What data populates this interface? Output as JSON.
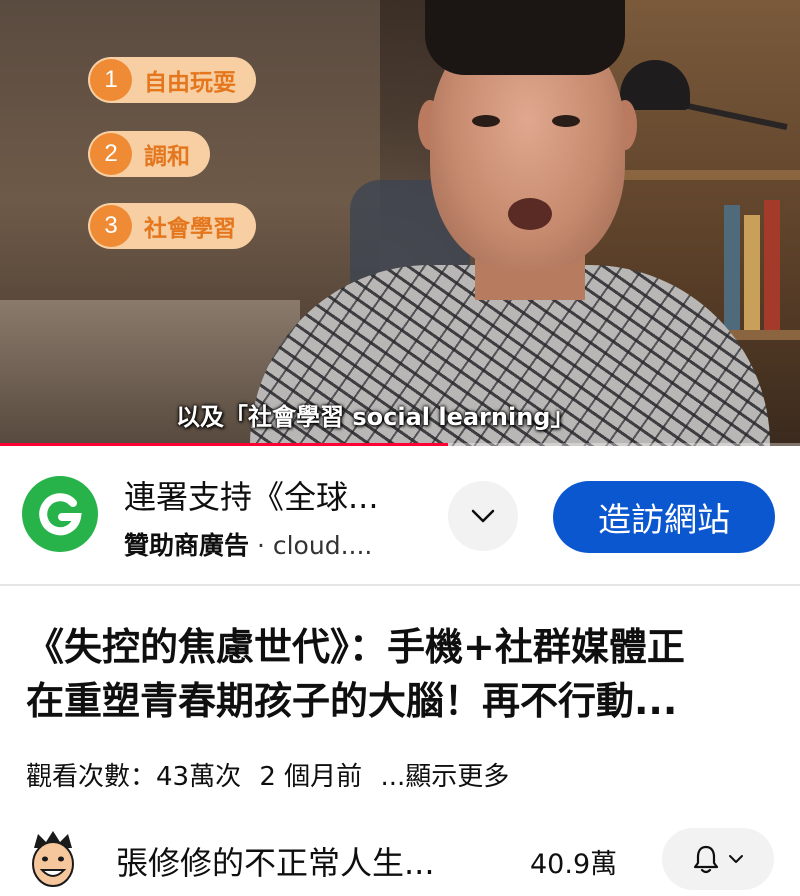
{
  "video": {
    "chapters": [
      {
        "num": "1",
        "label": "自由玩耍"
      },
      {
        "num": "2",
        "label": "調和"
      },
      {
        "num": "3",
        "label": "社會學習"
      }
    ],
    "subtitle": "以及「社會學習 social learning」",
    "progress": 0.56,
    "accent_color": "#ff0033"
  },
  "ad": {
    "logo_icon": "g-logo-icon",
    "title": "連署支持《全球...",
    "sponsored_label": "贊助商廣告",
    "domain": "· cloud....",
    "expand_icon": "chevron-down-icon",
    "visit_label": "造訪網站",
    "button_color": "#0b57d0"
  },
  "title": {
    "line1": "《失控的焦慮世代》：手機+社群媒體正",
    "line2": "在重塑青春期孩子的大腦！再不行動..."
  },
  "meta": {
    "views": "觀看次數：43萬次",
    "age": "2 個月前",
    "more": "...顯示更多"
  },
  "channel": {
    "name": "張修修的不正常人生...",
    "subscribers": "40.9萬",
    "bell_icon": "bell-icon"
  }
}
